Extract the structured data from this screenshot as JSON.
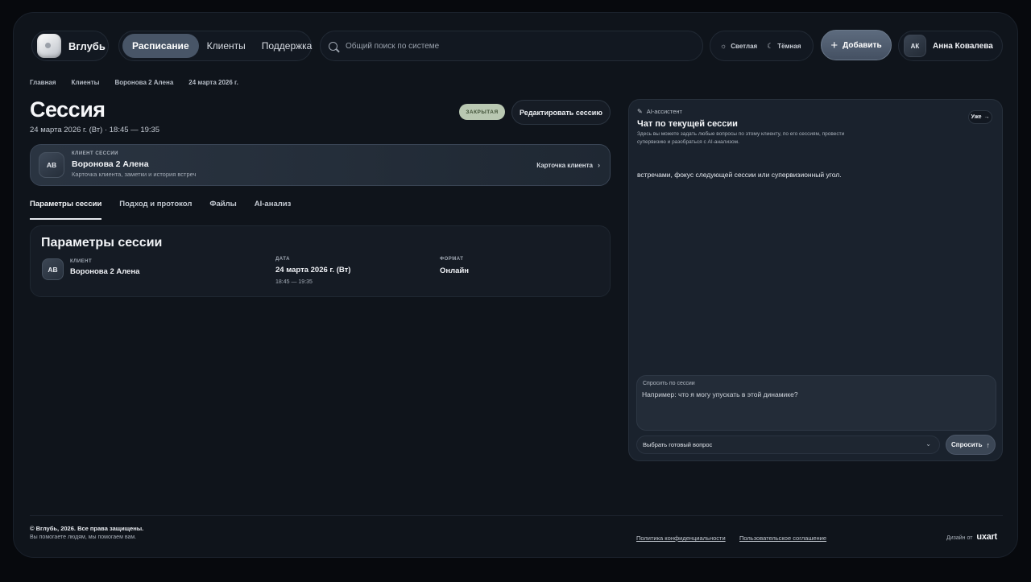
{
  "brand": {
    "name": "Вглубь"
  },
  "nav": {
    "items": [
      {
        "label": "Расписание",
        "active": true
      },
      {
        "label": "Клиенты"
      },
      {
        "label": "Поддержка"
      }
    ]
  },
  "search": {
    "placeholder": "Общий поиск по системе"
  },
  "theme": {
    "light_label": "Светлая",
    "dark_label": "Тёмная"
  },
  "header": {
    "add_label": "Добавить"
  },
  "user": {
    "initials": "АК",
    "name": "Анна Ковалева"
  },
  "breadcrumb": [
    "Главная",
    "Клиенты",
    "Воронова 2 Алена",
    "24 марта 2026 г."
  ],
  "session": {
    "title": "Сессия",
    "subtitle": "24 марта 2026 г. (Вт) · 18:45 — 19:35",
    "status": "ЗАКРЫТАЯ",
    "edit_label": "Редактировать сессию"
  },
  "client_card": {
    "initials": "АВ",
    "label": "КЛИЕНТ СЕССИИ",
    "name": "Воронова 2 Алена",
    "description": "Карточка клиента, заметки и история встреч",
    "link_label": "Карточка клиента"
  },
  "tabs": [
    "Параметры сессии",
    "Подход и протокол",
    "Файлы",
    "AI-анализ"
  ],
  "params": {
    "title": "Параметры сессии",
    "client_label": "КЛИЕНТ",
    "client_initials": "АВ",
    "client_value": "Воронова 2 Алена",
    "date_label": "ДАТА",
    "date_value": "24 марта 2026 г. (Вт)",
    "time_value": "18:45 — 19:35",
    "format_label": "ФОРМАТ",
    "format_value": "Онлайн"
  },
  "ai": {
    "label": "AI-ассистент",
    "title": "Чат по текущей сессии",
    "description": "Здесь вы можете задать любые вопросы по этому клиенту, по его сессиям, провести супервизию и разобраться с AI-анализом.",
    "wide_label": "Уже",
    "message": "встречами, фокус следующей сессии или супервизионный угол.",
    "ask_label": "Спросить по сессии",
    "ask_placeholder": "Например: что я могу упускать в этой динамике?",
    "preset_label": "Выбрать готовый вопрос",
    "ask_button": "Спросить"
  },
  "footer": {
    "copyright": "© Вглубь, 2026. Все права защищены.",
    "tagline": "Вы помогаете людям, мы помогаем вам.",
    "privacy": "Политика конфиденциальности",
    "terms": "Пользовательское соглашение",
    "design_by": "Дизайн от",
    "studio": "uxart"
  },
  "colors": {
    "status_badge_bg": "#b9c8b2",
    "accent_button": "#485567"
  }
}
